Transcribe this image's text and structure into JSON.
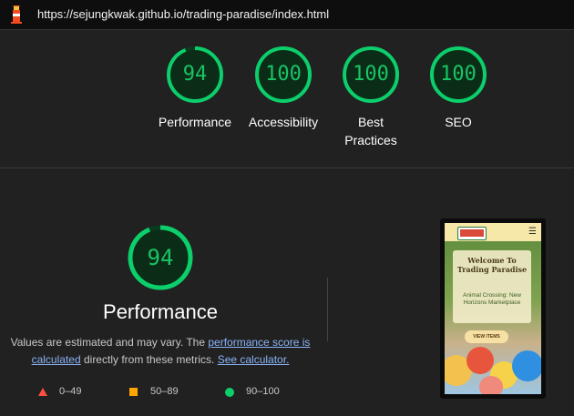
{
  "header": {
    "url": "https://sejungkwak.github.io/trading-paradise/index.html"
  },
  "colors": {
    "background": "#212121",
    "pass_green": "#0cce6b",
    "score_text_green": "#19c464",
    "link_blue": "#8ab4f8",
    "fail_red": "#ff4e42",
    "average_orange": "#ffa400"
  },
  "summary_scores": [
    {
      "label": "Performance",
      "score": "94",
      "fraction": 0.94
    },
    {
      "label": "Accessibility",
      "score": "100",
      "fraction": 1.0
    },
    {
      "label_line1": "Best",
      "label_line2": "Practices",
      "score": "100",
      "fraction": 1.0
    },
    {
      "label": "SEO",
      "score": "100",
      "fraction": 1.0
    }
  ],
  "performance": {
    "score": "94",
    "fraction": 0.94,
    "title": "Performance",
    "desc_text1": "Values are estimated and may vary. The ",
    "desc_link1": "performance score is calculated",
    "desc_text2": " directly from these metrics. ",
    "desc_link2": "See calculator."
  },
  "legend": [
    {
      "shape": "triangle",
      "label": "0–49"
    },
    {
      "shape": "square",
      "label": "50–89"
    },
    {
      "shape": "circle",
      "label": "90–100"
    }
  ],
  "screenshot": {
    "hero_title": "Welcome To Trading Paradise",
    "hero_subtitle": "Animal Crossing: New Horizons Marketplace",
    "button_label": "VIEW ITEMS",
    "menu_icon": "☰"
  }
}
